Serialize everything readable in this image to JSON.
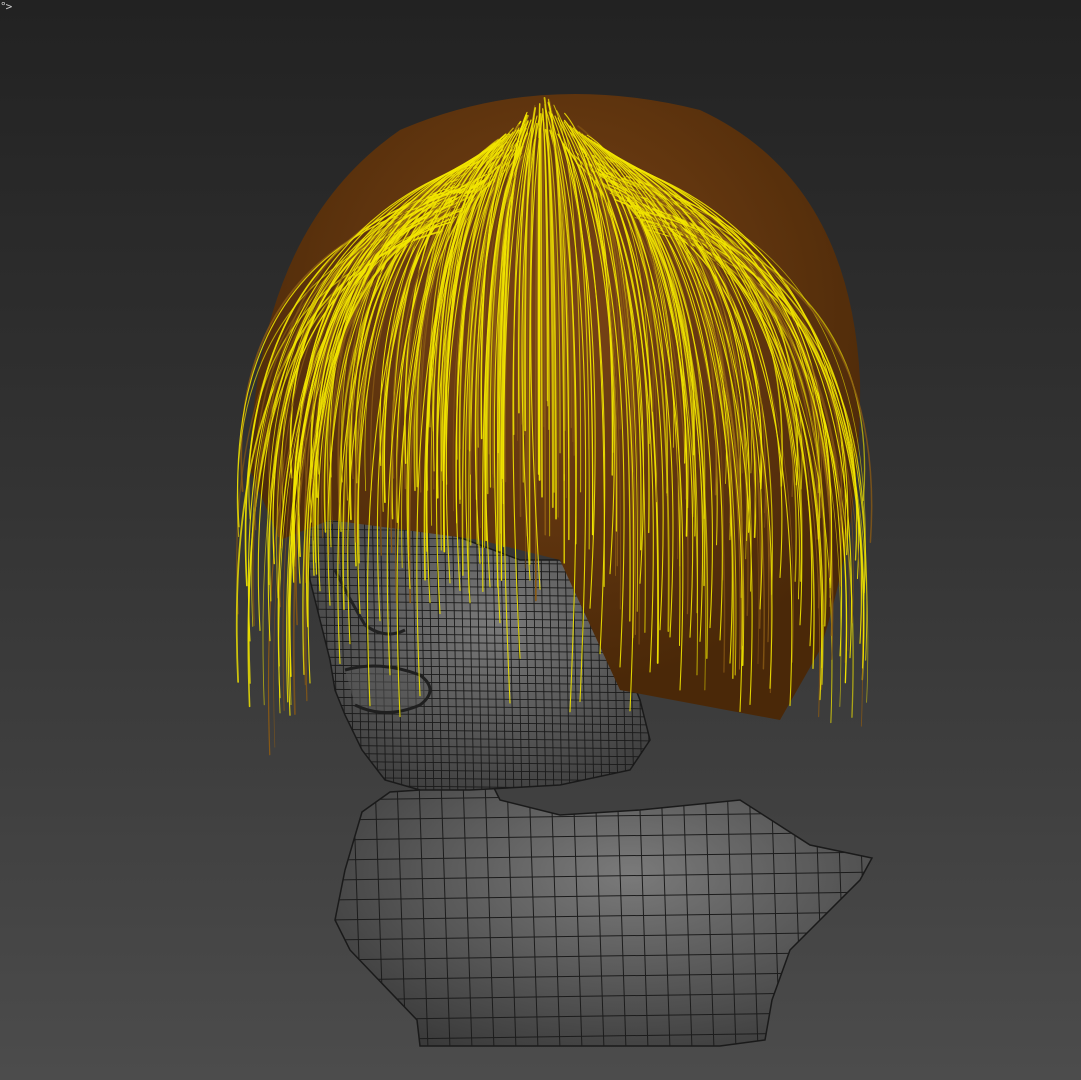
{
  "viewport": {
    "corner_label": "°>",
    "colors": {
      "background_top": "#222222",
      "background_bottom": "#4c4c4c",
      "mesh_fill": "#5a5a5a",
      "mesh_wire": "#1a1a1a",
      "hair_guides": "#f2e600",
      "hair_base": "#6b3a12"
    },
    "objects": [
      {
        "name": "head-bust-mesh",
        "display": "wireframe-on-shaded"
      },
      {
        "name": "hair-guides",
        "display": "spline-guides"
      }
    ]
  }
}
